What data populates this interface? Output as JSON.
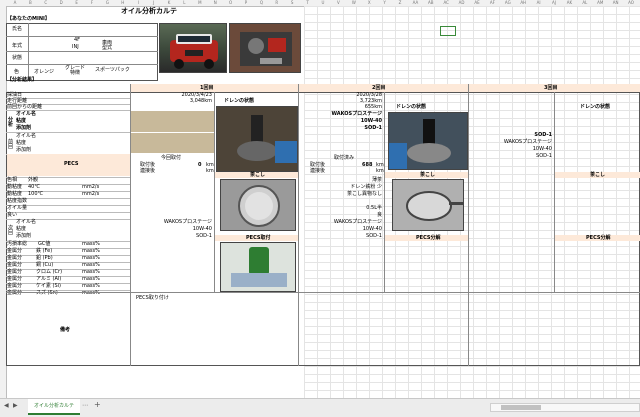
{
  "title": "オイル分析カルテ",
  "column_letters": [
    "A",
    "B",
    "C",
    "D",
    "E",
    "F",
    "G",
    "H",
    "I",
    "J",
    "K",
    "L",
    "M",
    "N",
    "O",
    "P",
    "Q",
    "R",
    "S",
    "T",
    "U",
    "V",
    "W",
    "X",
    "Y",
    "Z",
    "AA",
    "AB",
    "AC",
    "AD",
    "AE",
    "AF",
    "AG",
    "AH",
    "AI",
    "AJ",
    "AK",
    "AL",
    "AM",
    "AN",
    "AO"
  ],
  "vehicle": {
    "section_label": "【あなたのMINI】",
    "name_label": "氏名",
    "year_label": "年式",
    "model_label": "車両型式",
    "door_value": "4F",
    "inj_value": "INJ",
    "state_label": "状態",
    "color_label": "色",
    "color_value": "オレンジ",
    "grade_label": "グレード特徴",
    "grade_value": "スポーツパック"
  },
  "analysis": {
    "section_label": "【分析結果】",
    "round_labels": [
      "1回目",
      "2回目",
      "3回目"
    ],
    "row_labels": {
      "sample_date": "採油日",
      "mileage": "走行距離",
      "since_change": "前回からの距離",
      "oil_name": "オイル名",
      "viscosity": "粘度",
      "additive": "添加剤",
      "pecs": "PECS",
      "color": "色相",
      "appearance": "外観",
      "kin_visc": "動粘度",
      "temp40": "40℃",
      "temp100": "100℃",
      "unit_visc": "mm2/s",
      "visc_index": "粘度指数",
      "oil_amount": "オイル量",
      "good": "良い",
      "oil_name2": "オイル名",
      "viscosity2": "粘度",
      "additive2": "添加剤",
      "contamination": "汚損率総",
      "iron": "鉄 (Fe)",
      "lead": "鉛 (Pb)",
      "copper": "銅 (Cu)",
      "chromium": "クロム (Cr)",
      "aluminum": "アルミ (Al)",
      "silicon": "ケイ素 (Si)",
      "tin": "スズ (Sn)",
      "unit_mass": "mass%",
      "metal": "金属分",
      "remarks": "備考"
    },
    "side_labels": {
      "analysis": "分析",
      "previous": "前回",
      "next": "次回"
    },
    "round1": {
      "date": "2020/3/4/23",
      "mileage": "3,048km",
      "drain_label": "ドレンの状態",
      "pecs_label": "今回取付",
      "installed_after": "取付後",
      "installed_value": "0",
      "unit_km": "km",
      "connect_after": "連接後",
      "filter_label": "茶こし",
      "next_oil": "WAKOSプロステージ",
      "next_visc": "10W-40",
      "next_add": "SOD-1",
      "pecs_install_label": "PECS取付",
      "remark": "PECS取り付け"
    },
    "round2": {
      "date": "2020/3/28",
      "mileage": "3,723km",
      "since": "655km",
      "drain_label": "ドレンの状態",
      "oil_name": "WAKOSプロステージ",
      "viscosity": "10W-40",
      "additive": "SOD-1",
      "pecs_label": "取付済み",
      "installed_after": "取付後",
      "installed_value": "688",
      "unit_km": "km",
      "connect_after": "連接後",
      "color_value": "薄茶",
      "drain_iron": "ドレン鉄粉 少",
      "filter_iron": "茶こし異物なし",
      "oil_amount": "0.5L半",
      "good_value": "良",
      "filter_label": "茶こし",
      "next_oil": "WAKOSプロステージ",
      "next_visc": "10W-40",
      "next_add": "SOD-1",
      "pecs_analysis_label": "PECS分解"
    },
    "round3": {
      "drain_label": "ドレンの状態",
      "additive": "SOD-1",
      "next_oil": "WAKOSプロステージ",
      "next_visc": "10W-40",
      "next_add": "SOD-1",
      "filter_label": "茶こし",
      "pecs_analysis_label": "PECS分解"
    }
  },
  "sheet_tab": "オイル分析カルテ",
  "colors": {
    "band": "#fde9d9",
    "tan": "#c8b99a",
    "tab_green": "#2e7d32",
    "car_red": "#b3261e"
  }
}
